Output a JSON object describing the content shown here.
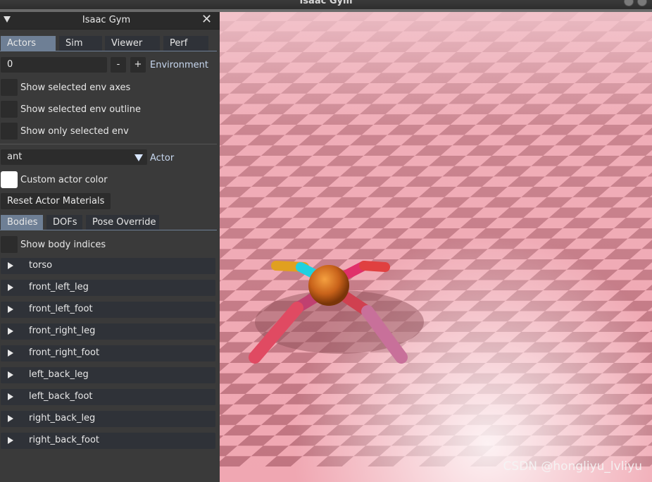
{
  "window": {
    "title": "Isaac Gym"
  },
  "panel": {
    "title": "Isaac Gym",
    "tabs": [
      "Actors",
      "Sim",
      "Viewer",
      "Perf"
    ],
    "environment": {
      "value": "0",
      "minus": "-",
      "plus": "+",
      "label": "Environment"
    },
    "checkboxes": [
      "Show selected env axes",
      "Show selected env outline",
      "Show only selected env"
    ],
    "actor": {
      "selected": "ant",
      "label": "Actor"
    },
    "custom_color_label": "Custom actor color",
    "reset_button": "Reset Actor Materials",
    "subtabs": [
      "Bodies",
      "DOFs",
      "Pose Override"
    ],
    "show_body_indices": "Show body indices",
    "bodies": [
      "torso",
      "front_left_leg",
      "front_left_foot",
      "front_right_leg",
      "front_right_foot",
      "left_back_leg",
      "left_back_foot",
      "right_back_leg",
      "right_back_foot"
    ]
  },
  "viewport": {
    "watermark": "CSDN @hongliyu_lvliyu"
  },
  "colors": {
    "accent": "#6e7f95",
    "panel_bg": "#3a3a3a",
    "ground_light": "#f0a7b2",
    "ground_dark": "#c07480"
  }
}
